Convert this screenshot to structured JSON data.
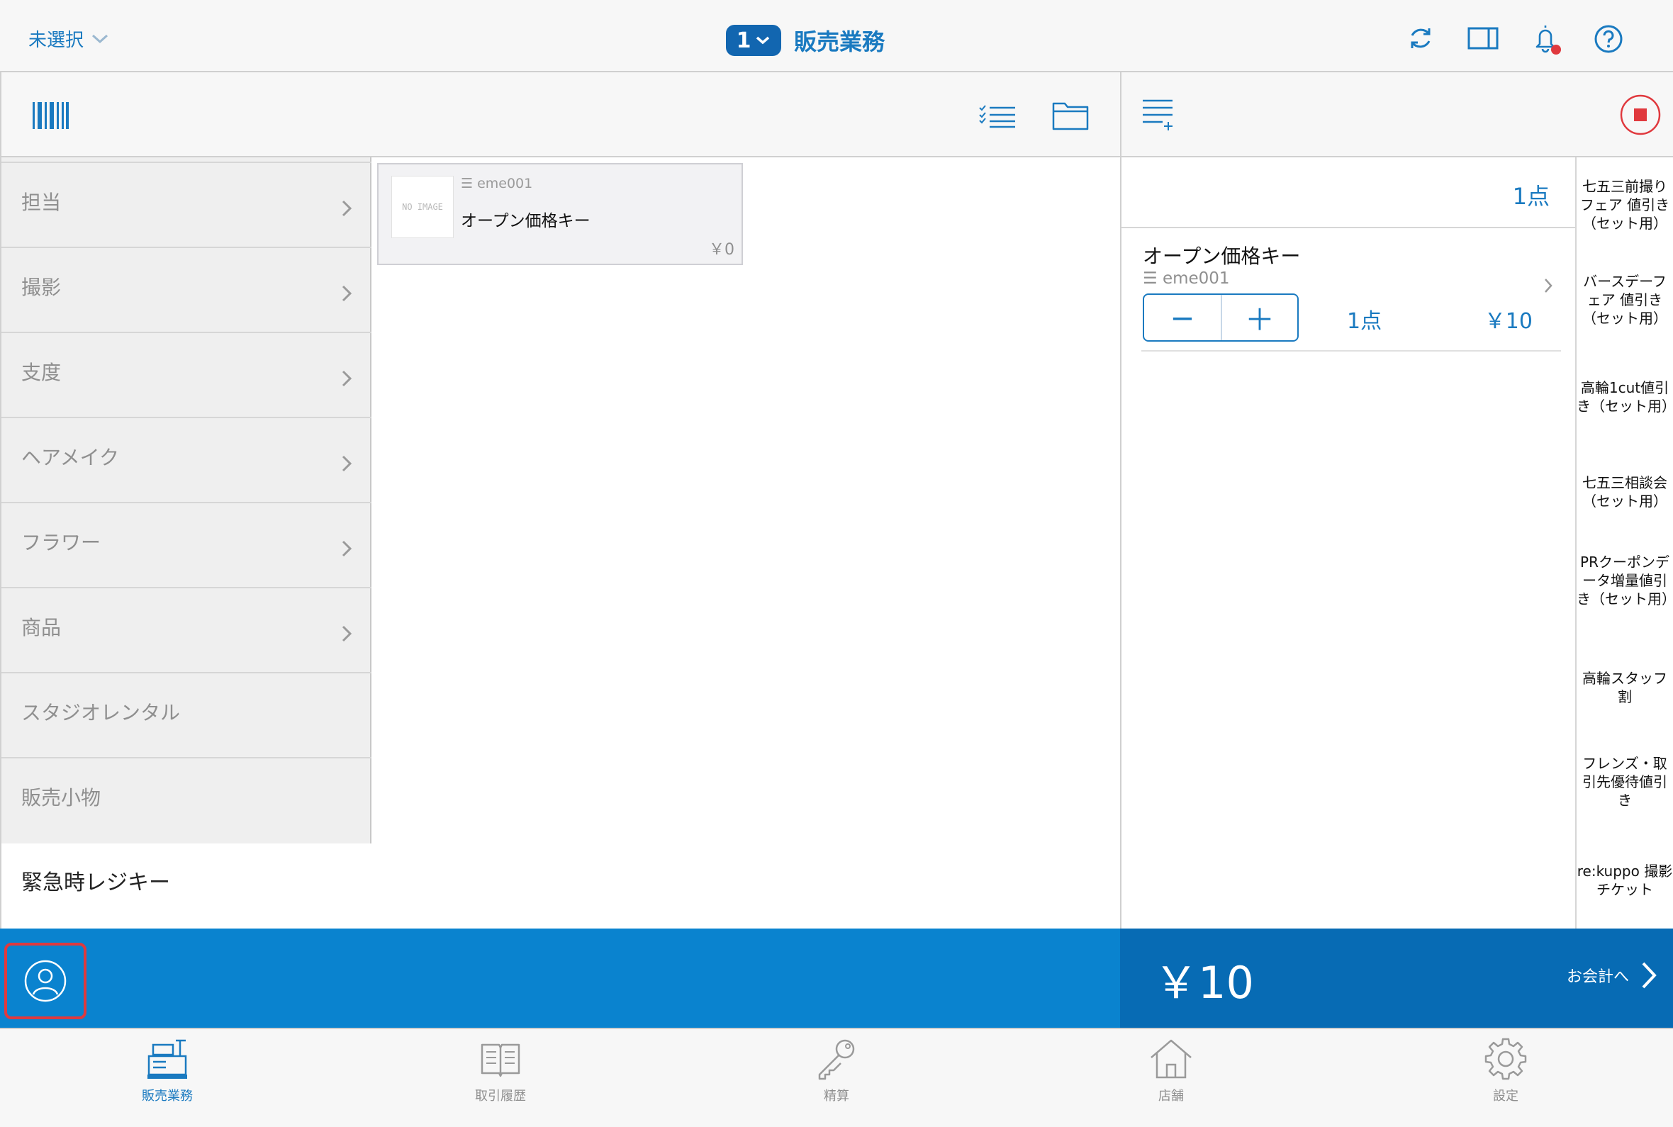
{
  "topbar": {
    "store_select": "未選択",
    "register_number": "1",
    "title": "販売業務"
  },
  "categories": [
    {
      "label": "担当",
      "has_children": true
    },
    {
      "label": "撮影",
      "has_children": true
    },
    {
      "label": "支度",
      "has_children": true
    },
    {
      "label": "ヘアメイク",
      "has_children": true
    },
    {
      "label": "フラワー",
      "has_children": true
    },
    {
      "label": "商品",
      "has_children": true
    },
    {
      "label": "スタジオレンタル",
      "has_children": false
    },
    {
      "label": "販売小物",
      "has_children": false
    }
  ],
  "emergency_key": "緊急時レジキー",
  "products": [
    {
      "image_text": "NO IMAGE",
      "code": "eme001",
      "name": "オープン価格キー",
      "price": "￥0"
    }
  ],
  "cart": {
    "total_count": "1点",
    "items": [
      {
        "name": "オープン価格キー",
        "code": "eme001",
        "minus": "−",
        "plus": "＋",
        "qty": "1点",
        "price": "￥10"
      }
    ]
  },
  "discounts": [
    "七五三前撮りフェア 値引き（セット用）",
    "バースデーフェア 値引き（セット用）",
    "高輪1cut値引き（セット用）",
    "七五三相談会（セット用）",
    "PRクーポンデータ増量値引き（セット用）",
    "高輪スタッフ割",
    "フレンズ・取引先優待値引き",
    "re:kuppo 撮影チケット"
  ],
  "footer": {
    "total": "￥10",
    "checkout_label": "お会計へ"
  },
  "tabs": [
    {
      "label": "販売業務",
      "icon": "register-icon",
      "active": true
    },
    {
      "label": "取引履歴",
      "icon": "book-icon",
      "active": false
    },
    {
      "label": "精算",
      "icon": "key-icon",
      "active": false
    },
    {
      "label": "店舗",
      "icon": "store-icon",
      "active": false
    },
    {
      "label": "設定",
      "icon": "gear-icon",
      "active": false
    }
  ],
  "colors": {
    "accent": "#1a7ac0",
    "footer_left": "#0a83cf",
    "footer_right": "#076bb4",
    "alert": "#e0393e"
  }
}
